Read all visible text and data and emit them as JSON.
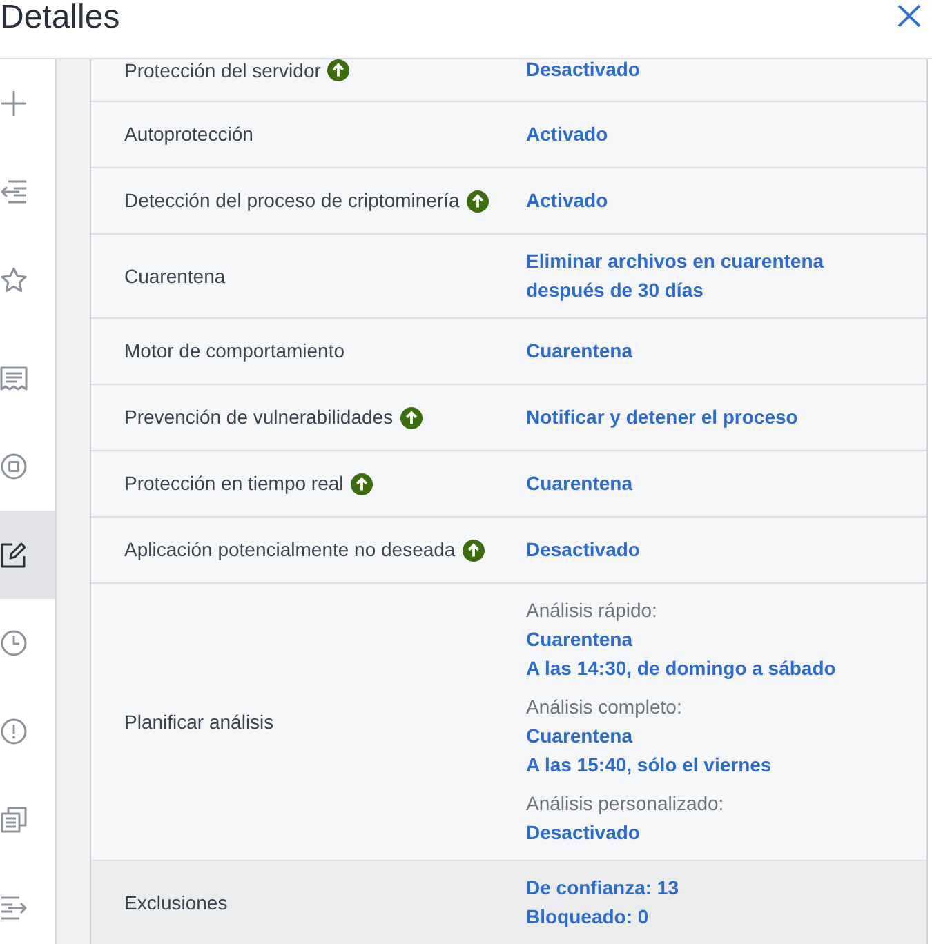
{
  "header": {
    "title": "Detalles"
  },
  "sidebar": {
    "groups": [
      {
        "items": [
          {
            "selected": false
          },
          {
            "selected": false
          },
          {
            "selected": false
          }
        ]
      },
      {
        "items": [
          {
            "selected": false
          },
          {
            "selected": false
          },
          {
            "selected": true
          },
          {
            "selected": false
          },
          {
            "selected": false
          },
          {
            "selected": false
          },
          {
            "selected": false
          }
        ]
      }
    ]
  },
  "rows": [
    {
      "label": "Protección del servidor",
      "upgrade": true,
      "highlighted": false,
      "kind": "text",
      "value": "Desactivado"
    },
    {
      "label": "Autoprotección",
      "upgrade": false,
      "highlighted": false,
      "kind": "text",
      "value": "Activado"
    },
    {
      "label": "Detección del proceso de criptominería",
      "upgrade": true,
      "highlighted": false,
      "kind": "text",
      "value": "Activado"
    },
    {
      "label": "Cuarentena",
      "upgrade": false,
      "highlighted": false,
      "kind": "text",
      "value": "Eliminar archivos en cuarentena después de 30 días"
    },
    {
      "label": "Motor de comportamiento",
      "upgrade": false,
      "highlighted": false,
      "kind": "text",
      "value": "Cuarentena"
    },
    {
      "label": "Prevención de vulnerabilidades",
      "upgrade": true,
      "highlighted": false,
      "kind": "text",
      "value": "Notificar y detener el proceso"
    },
    {
      "label": "Protección en tiempo real",
      "upgrade": true,
      "highlighted": false,
      "kind": "text",
      "value": "Cuarentena"
    },
    {
      "label": "Aplicación potencialmente no deseada",
      "upgrade": true,
      "highlighted": false,
      "kind": "text",
      "value": "Desactivado"
    },
    {
      "label": "Planificar análisis",
      "upgrade": false,
      "highlighted": false,
      "kind": "schedule",
      "entries": [
        {
          "heading": "Análisis rápido:",
          "lines": [
            "Cuarentena",
            "A las 14:30, de domingo a sábado"
          ]
        },
        {
          "heading": "Análisis completo:",
          "lines": [
            "Cuarentena",
            "A las 15:40, sólo el viernes"
          ]
        },
        {
          "heading": "Análisis personalizado:",
          "lines": [
            "Desactivado"
          ]
        }
      ]
    },
    {
      "label": "Exclusiones",
      "upgrade": false,
      "highlighted": true,
      "kind": "lines",
      "lines": [
        "De confianza: 13",
        "Bloqueado: 0"
      ]
    }
  ]
}
